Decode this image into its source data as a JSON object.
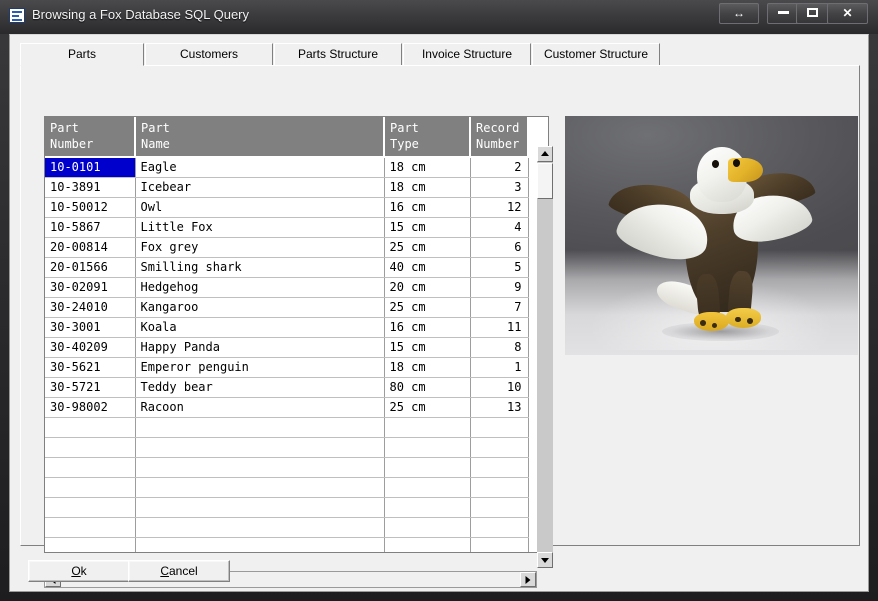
{
  "window": {
    "title": "Browsing a Fox Database SQL Query",
    "icon": "database-list-icon",
    "controls": {
      "resize_label": "↔",
      "minimize_label": "",
      "maximize_label": "",
      "close_label": "✕"
    }
  },
  "tabs": [
    {
      "label": "Parts",
      "active": true
    },
    {
      "label": "Customers",
      "active": false
    },
    {
      "label": "Parts Structure",
      "active": false
    },
    {
      "label": "Invoice Structure",
      "active": false
    },
    {
      "label": "Customer Structure",
      "active": false
    }
  ],
  "grid": {
    "columns": [
      {
        "line1": "Part",
        "line2": "Number"
      },
      {
        "line1": "Part",
        "line2": "Name"
      },
      {
        "line1": "Part",
        "line2": "Type"
      },
      {
        "line1": "Record",
        "line2": "Number"
      }
    ],
    "selected_cell": {
      "row": 0,
      "col": 0
    },
    "rows": [
      {
        "part_number": "10-0101",
        "part_name": "Eagle",
        "part_type": "18 cm",
        "record_number": "2"
      },
      {
        "part_number": "10-3891",
        "part_name": "Icebear",
        "part_type": "18 cm",
        "record_number": "3"
      },
      {
        "part_number": "10-50012",
        "part_name": "Owl",
        "part_type": "16 cm",
        "record_number": "12"
      },
      {
        "part_number": "10-5867",
        "part_name": "Little Fox",
        "part_type": "15 cm",
        "record_number": "4"
      },
      {
        "part_number": "20-00814",
        "part_name": "Fox grey",
        "part_type": "25 cm",
        "record_number": "6"
      },
      {
        "part_number": "20-01566",
        "part_name": "Smilling shark",
        "part_type": "40 cm",
        "record_number": "5"
      },
      {
        "part_number": "30-02091",
        "part_name": "Hedgehog",
        "part_type": "20 cm",
        "record_number": "9"
      },
      {
        "part_number": "30-24010",
        "part_name": "Kangaroo",
        "part_type": "25 cm",
        "record_number": "7"
      },
      {
        "part_number": "30-3001",
        "part_name": "Koala",
        "part_type": "16 cm",
        "record_number": "11"
      },
      {
        "part_number": "30-40209",
        "part_name": "Happy Panda",
        "part_type": "15 cm",
        "record_number": "8"
      },
      {
        "part_number": "30-5621",
        "part_name": "Emperor penguin",
        "part_type": "18 cm",
        "record_number": "1"
      },
      {
        "part_number": "30-5721",
        "part_name": "Teddy bear",
        "part_type": "80 cm",
        "record_number": "10"
      },
      {
        "part_number": "30-98002",
        "part_name": "Racoon",
        "part_type": "25 cm",
        "record_number": "13"
      }
    ],
    "empty_row_count": 9
  },
  "preview": {
    "image_alt": "plush bald eagle toy photo"
  },
  "buttons": {
    "ok_label": "Ok",
    "ok_mnemonic": "O",
    "cancel_label": "Cancel",
    "cancel_mnemonic": "C"
  },
  "colors": {
    "selection": "#0000cd",
    "header_bg": "#808080",
    "window_chrome": "#3a3a3c",
    "dialog_face": "#f0f0f0"
  }
}
